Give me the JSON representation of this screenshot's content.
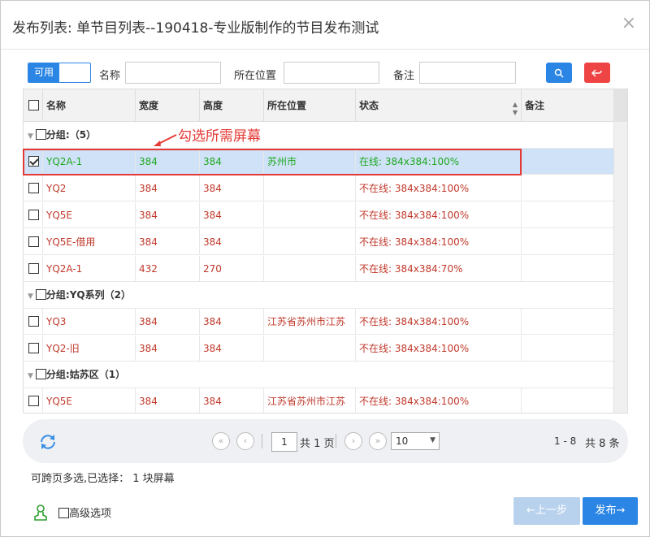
{
  "dialog": {
    "title": "发布列表: 单节目列表--190418-专业版制作的节目发布测试",
    "close": "×"
  },
  "toolbar": {
    "toggle_label": "可用",
    "name_label": "名称",
    "location_label": "所在位置",
    "remark_label": "备注",
    "name_value": "",
    "location_value": "",
    "remark_value": ""
  },
  "columns": [
    "名称",
    "宽度",
    "高度",
    "所在位置",
    "状态",
    "备注"
  ],
  "groups": [
    {
      "label": "分组:（5）"
    },
    {
      "label": "分组:YQ系列（2）"
    },
    {
      "label": "分组:姑苏区（1）"
    }
  ],
  "rows": [
    {
      "name": "YQ2A-1",
      "width": "384",
      "height": "384",
      "location": "苏州市",
      "status": "在线: 384x384:100%",
      "remark": "",
      "checked": true
    },
    {
      "name": "YQ2",
      "width": "384",
      "height": "384",
      "location": "",
      "status": "不在线: 384x384:100%",
      "remark": "",
      "checked": false
    },
    {
      "name": "YQ5E",
      "width": "384",
      "height": "384",
      "location": "",
      "status": "不在线: 384x384:100%",
      "remark": "",
      "checked": false
    },
    {
      "name": "YQ5E-借用",
      "width": "384",
      "height": "384",
      "location": "",
      "status": "不在线: 384x384:100%",
      "remark": "",
      "checked": false
    },
    {
      "name": "YQ2A-1",
      "width": "432",
      "height": "270",
      "location": "",
      "status": "不在线: 384x384:70%",
      "remark": "",
      "checked": false
    },
    {
      "name": "YQ3",
      "width": "384",
      "height": "384",
      "location": "江苏省苏州市江苏",
      "status": "不在线: 384x384:100%",
      "remark": "",
      "checked": false
    },
    {
      "name": "YQ2-旧",
      "width": "384",
      "height": "384",
      "location": "",
      "status": "不在线: 384x384:100%",
      "remark": "",
      "checked": false
    },
    {
      "name": "YQ5E",
      "width": "384",
      "height": "384",
      "location": "江苏省苏州市江苏",
      "status": "不在线: 384x384:100%",
      "remark": "",
      "checked": false
    }
  ],
  "annotation": "勾选所需屏幕",
  "pager": {
    "page": "1",
    "total_pages": "共 1 页",
    "page_size": "10",
    "range": "1 - 8",
    "total": "共 8 条"
  },
  "footer": {
    "note": "可跨页多选,已选择：  1 块屏幕",
    "advanced": "高级选项",
    "prev": "←上一步",
    "next": "发布→"
  },
  "colors": {
    "primary": "#2b85e4",
    "danger": "#ef4444",
    "offline": "#c0392b",
    "online": "#1ea81e",
    "selected_row": "#cfe2f8"
  }
}
